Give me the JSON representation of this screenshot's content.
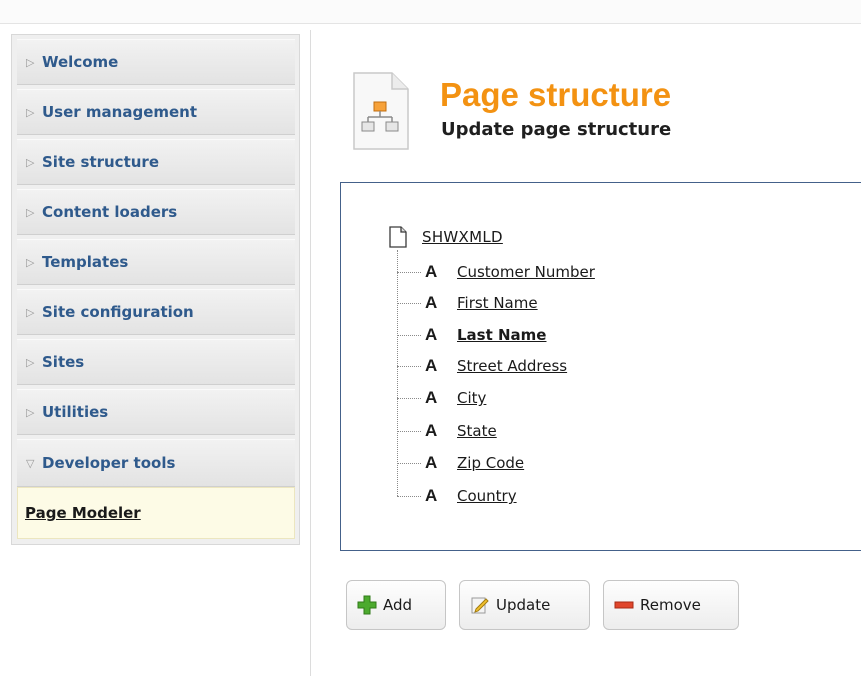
{
  "sidebar": {
    "items": [
      {
        "label": "Welcome"
      },
      {
        "label": "User management"
      },
      {
        "label": "Site structure"
      },
      {
        "label": "Content loaders"
      },
      {
        "label": "Templates"
      },
      {
        "label": "Site configuration"
      },
      {
        "label": "Sites"
      },
      {
        "label": "Utilities"
      },
      {
        "label": "Developer tools"
      }
    ],
    "subitem": "Page Modeler"
  },
  "header": {
    "title": "Page structure",
    "subtitle": "Update page structure"
  },
  "tree": {
    "root": "SHWXMLD",
    "children": [
      {
        "label": "Customer Number"
      },
      {
        "label": "First Name"
      },
      {
        "label": "Last Name"
      },
      {
        "label": "Street Address"
      },
      {
        "label": "City"
      },
      {
        "label": "State"
      },
      {
        "label": "Zip Code"
      },
      {
        "label": "Country"
      }
    ]
  },
  "buttons": {
    "add": "Add",
    "update": "Update",
    "remove": "Remove"
  },
  "colors": {
    "title": "#f39212",
    "nav_label": "#2f5a8c",
    "panel_border": "#44618a"
  }
}
